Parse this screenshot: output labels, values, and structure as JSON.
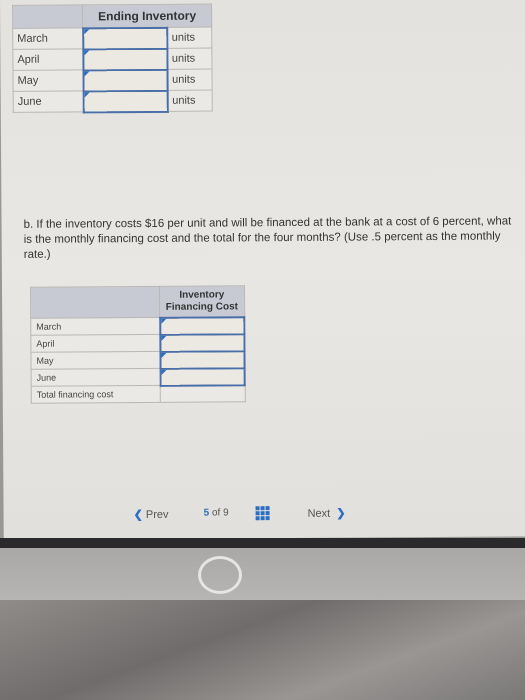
{
  "table1": {
    "header": "Ending Inventory",
    "rows": [
      {
        "month": "March",
        "value": "",
        "unit": "units"
      },
      {
        "month": "April",
        "value": "",
        "unit": "units"
      },
      {
        "month": "May",
        "value": "",
        "unit": "units"
      },
      {
        "month": "June",
        "value": "",
        "unit": "units"
      }
    ]
  },
  "question": "b. If the inventory costs $16 per unit and will be financed at the bank at a cost of 6 percent, what is the monthly financing cost and the total for the four months? (Use .5 percent as the monthly rate.)",
  "table2": {
    "header": "Inventory Financing Cost",
    "rows": [
      {
        "label": "March",
        "value": ""
      },
      {
        "label": "April",
        "value": ""
      },
      {
        "label": "May",
        "value": ""
      },
      {
        "label": "June",
        "value": ""
      },
      {
        "label": "Total financing cost",
        "value": ""
      }
    ]
  },
  "nav": {
    "prev": "Prev",
    "current": "5",
    "of": "of",
    "total": "9",
    "next": "Next",
    "prev_icon": "chevron-left",
    "next_icon": "chevron-right",
    "grid_icon": "grid"
  },
  "colors": {
    "accent": "#2b6fc4",
    "header_bg": "#c7cad2"
  }
}
